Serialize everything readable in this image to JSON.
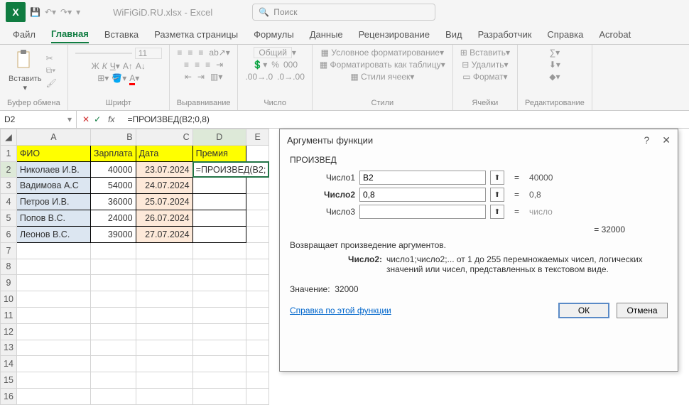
{
  "title": "WiFiGiD.RU.xlsx  -  Excel",
  "search_placeholder": "Поиск",
  "tabs": [
    "Файл",
    "Главная",
    "Вставка",
    "Разметка страницы",
    "Формулы",
    "Данные",
    "Рецензирование",
    "Вид",
    "Разработчик",
    "Справка",
    "Acrobat"
  ],
  "ribbon": {
    "paste": "Вставить",
    "font_size": "11",
    "num_format": "Общий",
    "cond": "Условное форматирование",
    "as_table": "Форматировать как таблицу",
    "styles": "Стили ячеек",
    "insert": "Вставить",
    "delete": "Удалить",
    "format": "Формат",
    "g_clip": "Буфер обмена",
    "g_font": "Шрифт",
    "g_align": "Выравнивание",
    "g_num": "Число",
    "g_styles": "Стили",
    "g_cells": "Ячейки",
    "g_edit": "Редактирование"
  },
  "namebox": "D2",
  "formula": "=ПРОИЗВЕД(B2;0,8)",
  "cols": [
    "A",
    "B",
    "C",
    "D",
    "E"
  ],
  "headers": {
    "A": "ФИО",
    "B": "Зарплата",
    "C": "Дата",
    "D": "Премия"
  },
  "rows": [
    {
      "A": "Николаев И.В.",
      "B": "40000",
      "C": "23.07.2024",
      "D": "=ПРОИЗВЕД(B2;"
    },
    {
      "A": "Вадимова А.С",
      "B": "54000",
      "C": "24.07.2024",
      "D": ""
    },
    {
      "A": "Петров И.В.",
      "B": "36000",
      "C": "25.07.2024",
      "D": ""
    },
    {
      "A": "Попов В.С.",
      "B": "24000",
      "C": "26.07.2024",
      "D": ""
    },
    {
      "A": "Леонов В.С.",
      "B": "39000",
      "C": "27.07.2024",
      "D": ""
    }
  ],
  "dialog": {
    "title": "Аргументы функции",
    "fn": "ПРОИЗВЕД",
    "args": [
      {
        "label": "Число1",
        "value": "B2",
        "result": "40000"
      },
      {
        "label": "Число2",
        "value": "0,8",
        "result": "0,8"
      },
      {
        "label": "Число3",
        "value": "",
        "result": "число"
      }
    ],
    "eq_result": "=   32000",
    "desc1": "Возвращает произведение аргументов.",
    "desc2_key": "Число2:",
    "desc2_val": "число1;число2;... от 1 до 255 перемножаемых чисел, логических значений или чисел, представленных в текстовом виде.",
    "value_label": "Значение:",
    "value": "32000",
    "help": "Справка по этой функции",
    "ok": "ОК",
    "cancel": "Отмена"
  }
}
